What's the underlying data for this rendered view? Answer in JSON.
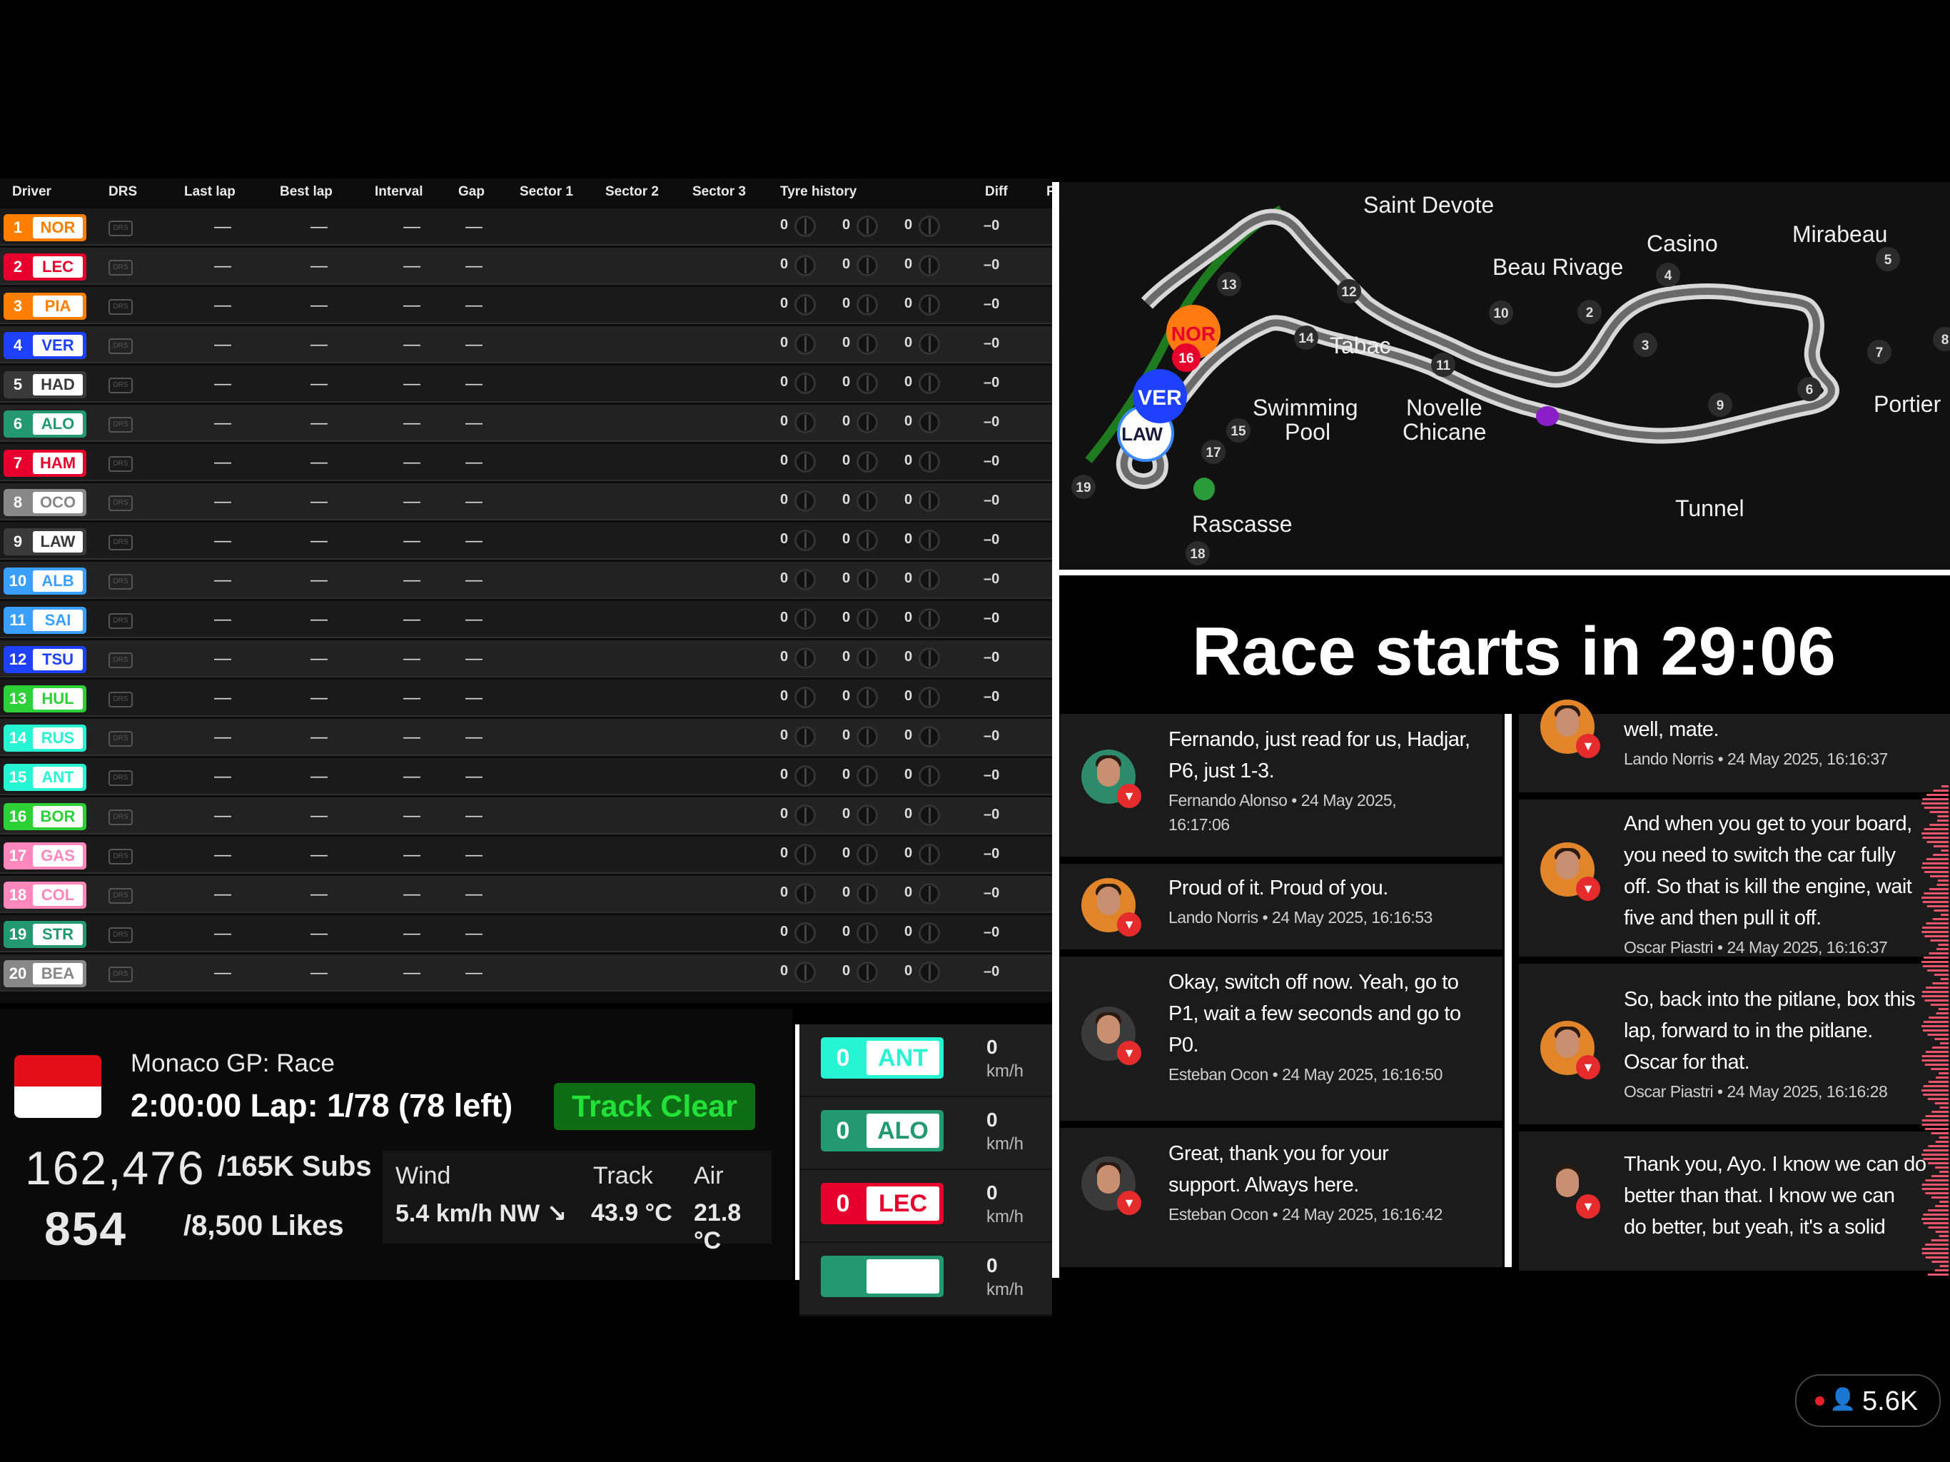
{
  "timing": {
    "headers": [
      "Driver",
      "DRS",
      "Last lap",
      "Best lap",
      "Interval",
      "Gap",
      "Sector 1",
      "Sector 2",
      "Sector 3",
      "Tyre history",
      "Diff",
      "F"
    ],
    "drs_label": "DRS",
    "dash": "—",
    "tyre_count": "0",
    "diff_value": "–0",
    "drivers": [
      {
        "pos": "1",
        "code": "NOR",
        "color": "#ff8000"
      },
      {
        "pos": "2",
        "code": "LEC",
        "color": "#e8002d"
      },
      {
        "pos": "3",
        "code": "PIA",
        "color": "#ff8000"
      },
      {
        "pos": "4",
        "code": "VER",
        "color": "#1e41ff"
      },
      {
        "pos": "5",
        "code": "HAD",
        "color": "#3a3a3a"
      },
      {
        "pos": "6",
        "code": "ALO",
        "color": "#229971"
      },
      {
        "pos": "7",
        "code": "HAM",
        "color": "#e8002d"
      },
      {
        "pos": "8",
        "code": "OCO",
        "color": "#888888"
      },
      {
        "pos": "9",
        "code": "LAW",
        "color": "#3a3a3a"
      },
      {
        "pos": "10",
        "code": "ALB",
        "color": "#3aa0ff"
      },
      {
        "pos": "11",
        "code": "SAI",
        "color": "#3aa0ff"
      },
      {
        "pos": "12",
        "code": "TSU",
        "color": "#1e41ff"
      },
      {
        "pos": "13",
        "code": "HUL",
        "color": "#2bd136"
      },
      {
        "pos": "14",
        "code": "RUS",
        "color": "#27f4d2"
      },
      {
        "pos": "15",
        "code": "ANT",
        "color": "#27f4d2"
      },
      {
        "pos": "16",
        "code": "BOR",
        "color": "#2bd136"
      },
      {
        "pos": "17",
        "code": "GAS",
        "color": "#ff87bc"
      },
      {
        "pos": "18",
        "code": "COL",
        "color": "#ff87bc"
      },
      {
        "pos": "19",
        "code": "STR",
        "color": "#229971"
      },
      {
        "pos": "20",
        "code": "BEA",
        "color": "#888888"
      }
    ]
  },
  "map": {
    "labels": {
      "saint_devote": "Saint Devote",
      "beau_rivage": "Beau Rivage",
      "casino": "Casino",
      "mirabeau": "Mirabeau",
      "tabac": "Tabac",
      "swimming_pool_1": "Swimming",
      "swimming_pool_2": "Pool",
      "novelle_1": "Novelle",
      "novelle_2": "Chicane",
      "portier": "Portier",
      "tunnel": "Tunnel",
      "rascasse": "Rascasse"
    },
    "corners": [
      "2",
      "3",
      "4",
      "5",
      "6",
      "7",
      "8",
      "9",
      "10",
      "11",
      "12",
      "13",
      "14",
      "15",
      "16",
      "17",
      "18",
      "19"
    ],
    "cars": {
      "nor": "NOR",
      "ver": "VER",
      "law": "LAW",
      "nor_num": "16"
    }
  },
  "countdown": {
    "text": "Race starts in 29:06"
  },
  "radio_left": [
    {
      "line1": "Fernando, just read for us, Hadjar,",
      "line2": "P6, just 1-3.",
      "meta1": "Fernando Alonso • 24 May 2025,",
      "meta2": "16:17:06"
    },
    {
      "line1": "Proud of it. Proud of you.",
      "meta1": "Lando Norris • 24 May 2025, 16:16:53"
    },
    {
      "line1": "Okay, switch off now. Yeah, go to",
      "line2": "P1, wait a few seconds and go to",
      "line3": "P0.",
      "meta1": "Esteban Ocon • 24 May 2025, 16:16:50"
    },
    {
      "line1": "Great, thank you for your",
      "line2": "support. Always here.",
      "meta1": "Esteban Ocon • 24 May 2025, 16:16:42"
    }
  ],
  "radio_right": [
    {
      "line1": "well, mate.",
      "meta1": "Lando Norris • 24 May 2025, 16:16:37"
    },
    {
      "line1": "And when you get to your board,",
      "line2": "you need to switch the car fully",
      "line3": "off. So that is kill the engine, wait",
      "line4": "five and then pull it off.",
      "meta1": "Oscar Piastri • 24 May 2025, 16:16:37"
    },
    {
      "line1": "So, back into the pitlane, box this",
      "line2": "lap, forward to in the pitlane.",
      "line3": "Oscar for that.",
      "meta1": "Oscar Piastri • 24 May 2025, 16:16:28"
    },
    {
      "line1": "Thank you, Ayo. I know we can do",
      "line2": "better than that. I know we can",
      "line3": "do better, but yeah, it's a solid"
    }
  ],
  "info": {
    "race_name": "Monaco GP: Race",
    "race_time": "2:00:00 Lap: 1/78 (78 left)",
    "track_status": "Track Clear",
    "subs_num": "162,476",
    "subs_label": "/165K Subs",
    "likes_num": "854",
    "likes_label": "/8,500 Likes",
    "wind_label": "Wind",
    "wind_value": "5.4 km/h NW ↘",
    "track_label": "Track",
    "track_value": "43.9 °C",
    "air_label": "Air",
    "air_value": "21.8 °C"
  },
  "speed": {
    "unit": "km/h",
    "rows": [
      {
        "pos": "0",
        "code": "ANT",
        "speed": "0",
        "color": "#27f4d2"
      },
      {
        "pos": "0",
        "code": "ALO",
        "speed": "0",
        "color": "#229971"
      },
      {
        "pos": "0",
        "code": "LEC",
        "speed": "0",
        "color": "#e8002d"
      },
      {
        "pos": "",
        "code": "",
        "speed": "0",
        "color": "#229971"
      }
    ]
  },
  "viewers": {
    "count": "5.6K"
  }
}
